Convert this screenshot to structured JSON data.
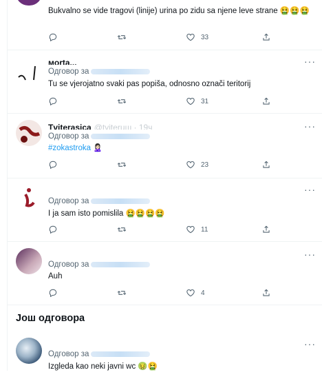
{
  "tweets": [
    {
      "id": "t1",
      "name": "",
      "handle": "",
      "reply_prefix": "",
      "text": "Bukvalno se vide tragovi (linije)  urina po zidu sa njene leve strane 🤮🤮🤮",
      "replies": "",
      "retweets": "",
      "likes": "33",
      "avatar_color": "#6b2f7a"
    },
    {
      "id": "t2",
      "name": "мorta...",
      "handle": "",
      "reply_prefix": "Одговор за",
      "text": "Tu se vjerojatno svaki pas popiša, odnosno označi teritorij",
      "replies": "",
      "retweets": "",
      "likes": "31",
      "avatar_color": "#ffffff"
    },
    {
      "id": "t3",
      "name": "Tviterasica",
      "handle": "@tviteruш · 19ч",
      "reply_prefix": "Одговор за",
      "text_hashtag": "#zokastroka",
      "text_emoji": "🙎🏻‍♀️",
      "replies": "",
      "retweets": "",
      "likes": "23",
      "avatar_color": "#8b1a1a"
    },
    {
      "id": "t4",
      "name": "",
      "handle": "",
      "reply_prefix": "Одговор за",
      "text": "I ja sam isto pomislila 🤮🤮🤮🤮",
      "replies": "",
      "retweets": "",
      "likes": "11",
      "avatar_color": "#9b1c2a"
    },
    {
      "id": "t5",
      "name": "",
      "handle": "",
      "reply_prefix": "Одговор за",
      "text": "Auh",
      "replies": "",
      "retweets": "",
      "likes": "4",
      "avatar_color": "#5a2d5c"
    },
    {
      "id": "t6",
      "name": "",
      "handle": "",
      "reply_prefix": "Одговор за",
      "text": "Izgleda kao neki javni wc 🤢🤮",
      "replies": "",
      "retweets": "",
      "likes": "",
      "avatar_color": "#2c4a6b"
    }
  ],
  "section": {
    "more_replies": "Још одговора"
  },
  "icons": {
    "reply": "reply-icon",
    "retweet": "retweet-icon",
    "like": "like-icon",
    "share": "share-icon",
    "more": "more-icon"
  },
  "colors": {
    "accent": "#1d9bf0",
    "secondary_text": "#536471",
    "border": "#eff3f4"
  }
}
